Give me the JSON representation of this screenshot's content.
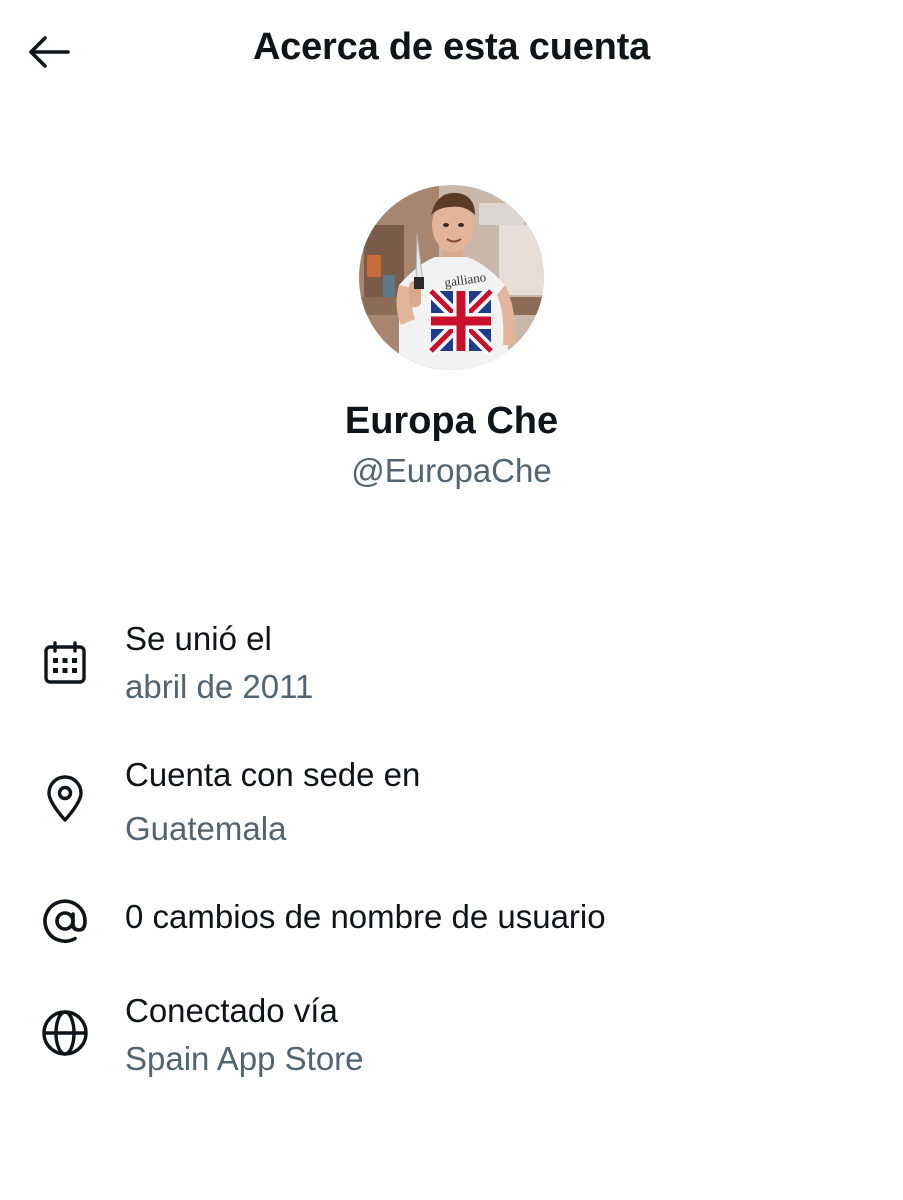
{
  "header": {
    "title": "Acerca de esta cuenta",
    "back_icon": "arrow-left-icon"
  },
  "profile": {
    "display_name": "Europa Che",
    "handle": "@EuropaChe",
    "avatar_shirt_text": "galliano"
  },
  "details": [
    {
      "icon": "calendar-icon",
      "label": "Se unió el",
      "value": "abril de 2011"
    },
    {
      "icon": "location-pin-icon",
      "label": "Cuenta con sede en",
      "value": "Guatemala"
    },
    {
      "icon": "at-sign-icon",
      "label": "0 cambios de nombre de usuario"
    },
    {
      "icon": "globe-icon",
      "label": "Conectado vía",
      "value": "Spain App Store"
    }
  ],
  "colors": {
    "primary_text": "#0f1419",
    "secondary_text": "#536471",
    "background": "#ffffff"
  }
}
